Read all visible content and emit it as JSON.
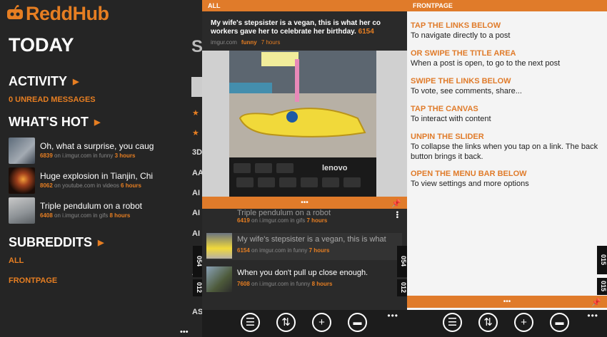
{
  "app": {
    "name": "ReddHub"
  },
  "left": {
    "today": "TODAY",
    "activity": "ACTIVITY",
    "unread": "0 UNREAD MESSAGES",
    "whats_hot": "WHAT'S HOT",
    "hot_items": [
      {
        "title": "Oh, what a surprise, you caug",
        "score": "6839",
        "on": "on",
        "domain": "i.imgur.com",
        "in": "in",
        "sub": "funny",
        "age": "3 hours"
      },
      {
        "title": "Huge explosion in Tianjin, Chi",
        "score": "8062",
        "on": "on",
        "domain": "youtube.com",
        "in": "in",
        "sub": "videos",
        "age": "6 hours"
      },
      {
        "title": "Triple pendulum on a robot",
        "score": "6408",
        "on": "on",
        "domain": "i.imgur.com",
        "in": "in",
        "sub": "gifs",
        "age": "8 hours"
      }
    ],
    "subreddits": "SUBREDDITS",
    "sub_all": "ALL",
    "sub_front": "FRONTPAGE",
    "ghost": [
      "S",
      "3D",
      "AA",
      "AI",
      "AI",
      "AI",
      "AI",
      "AS"
    ]
  },
  "middle": {
    "header": "ALL",
    "post": {
      "title": "My wife's stepsister is a vegan, this is what her co workers gave her to celebrate her birthday.",
      "score": "6154",
      "domain": "imgur.com",
      "sub": "funny",
      "age": "7 hours"
    },
    "list": [
      {
        "title": "Triple pendulum on a robot",
        "score": "6419",
        "on": "on",
        "domain": "i.imgur.com",
        "in": "in",
        "sub": "gifs",
        "age": "7 hours"
      },
      {
        "title": "My wife's stepsister is a vegan, this is what",
        "score": "6154",
        "on": "on",
        "domain": "imgur.com",
        "in": "in",
        "sub": "funny",
        "age": "7 hours"
      },
      {
        "title": "When you don't pull up close enough.",
        "score": "7608",
        "on": "on",
        "domain": "i.imgur.com",
        "in": "in",
        "sub": "funny",
        "age": "8 hours"
      }
    ],
    "side_tab_a": "054",
    "side_tab_b": "012",
    "left_tab_a": "054",
    "left_tab_b": "012",
    "more": "•••",
    "grip": "•••"
  },
  "right": {
    "header": "FRONTPAGE",
    "tips": [
      {
        "h": "TAP THE LINKS BELOW",
        "b": "To navigate directly to a post"
      },
      {
        "h": "OR SWIPE THE TITLE AREA",
        "b": "When a post is open, to go to the next post"
      },
      {
        "h": "SWIPE THE LINKS BELOW",
        "b": "To vote, see comments, share..."
      },
      {
        "h": "TAP THE CANVAS",
        "b": "To interact with content"
      },
      {
        "h": "UNPIN THE SLIDER",
        "b": "To collapse the links when you tap on a link. The back button brings it back."
      },
      {
        "h": "OPEN THE MENU BAR BELOW",
        "b": "To view settings and more options"
      }
    ],
    "side_tab_a": "015",
    "side_tab_b": "015",
    "more": "•••",
    "grip": "•••"
  },
  "colors": {
    "accent": "#e07b2a",
    "dark": "#252525",
    "light": "#f4f4f4"
  },
  "icons": [
    "list-icon",
    "vote-icon",
    "add-icon",
    "comment-icon",
    "pin-icon"
  ]
}
